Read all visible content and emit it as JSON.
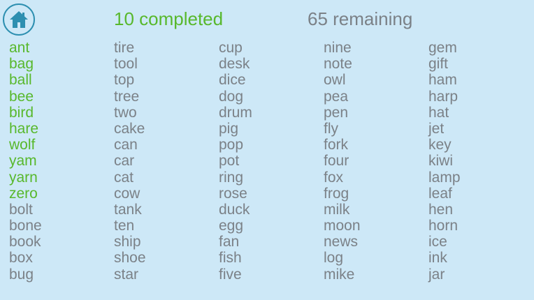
{
  "header": {
    "home_icon": "home-icon",
    "completed_label": "10 completed",
    "remaining_label": "65 remaining"
  },
  "colors": {
    "background": "#cde8f7",
    "done": "#58b82c",
    "pending": "#7b8187",
    "home_icon": "#2d8fb0"
  },
  "columns": [
    [
      {
        "text": "ant",
        "done": true
      },
      {
        "text": "bag",
        "done": true
      },
      {
        "text": "ball",
        "done": true
      },
      {
        "text": "bee",
        "done": true
      },
      {
        "text": "bird",
        "done": true
      },
      {
        "text": "hare",
        "done": true
      },
      {
        "text": "wolf",
        "done": true
      },
      {
        "text": "yam",
        "done": true
      },
      {
        "text": "yarn",
        "done": true
      },
      {
        "text": "zero",
        "done": true
      },
      {
        "text": "bolt",
        "done": false
      },
      {
        "text": "bone",
        "done": false
      },
      {
        "text": "book",
        "done": false
      },
      {
        "text": "box",
        "done": false
      },
      {
        "text": "bug",
        "done": false
      }
    ],
    [
      {
        "text": "tire",
        "done": false
      },
      {
        "text": "tool",
        "done": false
      },
      {
        "text": "top",
        "done": false
      },
      {
        "text": "tree",
        "done": false
      },
      {
        "text": "two",
        "done": false
      },
      {
        "text": "cake",
        "done": false
      },
      {
        "text": "can",
        "done": false
      },
      {
        "text": "car",
        "done": false
      },
      {
        "text": "cat",
        "done": false
      },
      {
        "text": "cow",
        "done": false
      },
      {
        "text": "tank",
        "done": false
      },
      {
        "text": "ten",
        "done": false
      },
      {
        "text": "ship",
        "done": false
      },
      {
        "text": "shoe",
        "done": false
      },
      {
        "text": "star",
        "done": false
      }
    ],
    [
      {
        "text": "cup",
        "done": false
      },
      {
        "text": "desk",
        "done": false
      },
      {
        "text": "dice",
        "done": false
      },
      {
        "text": "dog",
        "done": false
      },
      {
        "text": "drum",
        "done": false
      },
      {
        "text": "pig",
        "done": false
      },
      {
        "text": "pop",
        "done": false
      },
      {
        "text": "pot",
        "done": false
      },
      {
        "text": "ring",
        "done": false
      },
      {
        "text": "rose",
        "done": false
      },
      {
        "text": "duck",
        "done": false
      },
      {
        "text": "egg",
        "done": false
      },
      {
        "text": "fan",
        "done": false
      },
      {
        "text": "fish",
        "done": false
      },
      {
        "text": "five",
        "done": false
      }
    ],
    [
      {
        "text": "nine",
        "done": false
      },
      {
        "text": "note",
        "done": false
      },
      {
        "text": "owl",
        "done": false
      },
      {
        "text": "pea",
        "done": false
      },
      {
        "text": "pen",
        "done": false
      },
      {
        "text": "fly",
        "done": false
      },
      {
        "text": "fork",
        "done": false
      },
      {
        "text": "four",
        "done": false
      },
      {
        "text": "fox",
        "done": false
      },
      {
        "text": "frog",
        "done": false
      },
      {
        "text": "milk",
        "done": false
      },
      {
        "text": "moon",
        "done": false
      },
      {
        "text": "news",
        "done": false
      },
      {
        "text": "log",
        "done": false
      },
      {
        "text": "mike",
        "done": false
      }
    ],
    [
      {
        "text": "gem",
        "done": false
      },
      {
        "text": "gift",
        "done": false
      },
      {
        "text": "ham",
        "done": false
      },
      {
        "text": "harp",
        "done": false
      },
      {
        "text": "hat",
        "done": false
      },
      {
        "text": "jet",
        "done": false
      },
      {
        "text": "key",
        "done": false
      },
      {
        "text": "kiwi",
        "done": false
      },
      {
        "text": "lamp",
        "done": false
      },
      {
        "text": "leaf",
        "done": false
      },
      {
        "text": "hen",
        "done": false
      },
      {
        "text": "horn",
        "done": false
      },
      {
        "text": "ice",
        "done": false
      },
      {
        "text": "ink",
        "done": false
      },
      {
        "text": "jar",
        "done": false
      }
    ]
  ]
}
